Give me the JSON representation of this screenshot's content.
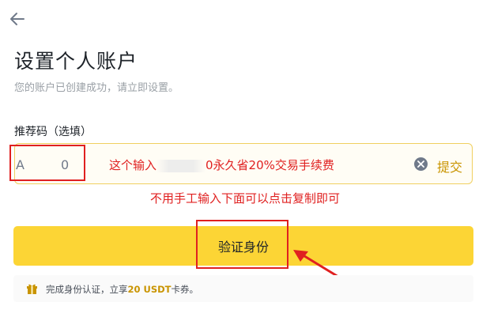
{
  "header": {
    "back_icon": "arrow-left-icon"
  },
  "page": {
    "title": "设置个人账户",
    "subtitle": "您的账户已创建成功，请立即设置。"
  },
  "referral": {
    "label": "推荐码（选填）",
    "value": "A     0",
    "clear_icon": "clear-circle-icon",
    "submit_label": "提交"
  },
  "annotations": {
    "line1_prefix": "这个输入",
    "line1_suffix": "0永久省20%交易手续费",
    "line2": "不用手工输入下面可以点击复制即可",
    "color": "#e02020"
  },
  "verify": {
    "button_label": "验证身份"
  },
  "reward": {
    "icon": "gift-icon",
    "text_before": "完成身份认证，立享",
    "amount": "20 USDT",
    "text_after": "卡券。"
  },
  "colors": {
    "accent_yellow": "#fcd535",
    "link_gold": "#c99400",
    "text_dark": "#1e2329",
    "text_muted": "#9aa0a6"
  }
}
